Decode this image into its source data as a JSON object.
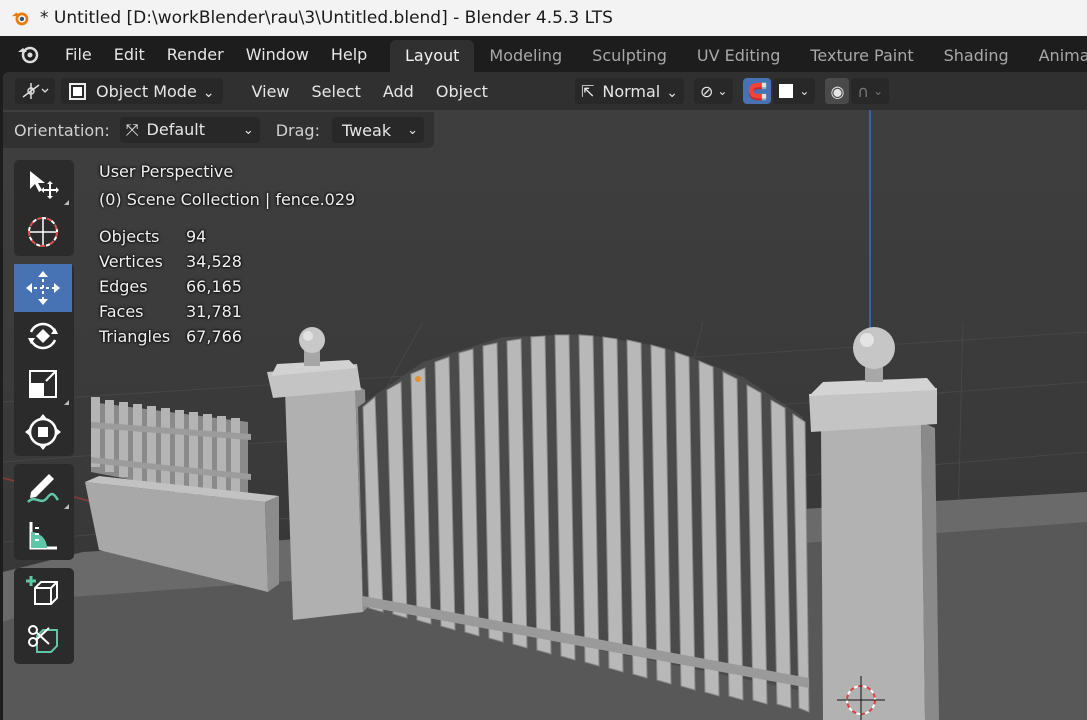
{
  "titlebar": {
    "title": "* Untitled [D:\\workBlender\\rau\\3\\Untitled.blend] - Blender 4.5.3 LTS"
  },
  "menu": {
    "items": [
      "File",
      "Edit",
      "Render",
      "Window",
      "Help"
    ]
  },
  "workspaces": {
    "tabs": [
      "Layout",
      "Modeling",
      "Sculpting",
      "UV Editing",
      "Texture Paint",
      "Shading",
      "Animation"
    ],
    "active": "Layout"
  },
  "header": {
    "mode": "Object Mode",
    "menus": [
      "View",
      "Select",
      "Add",
      "Object"
    ],
    "transform_orientation": "Normal"
  },
  "tool_settings": {
    "orientation_label": "Orientation:",
    "orientation_value": "Default",
    "drag_label": "Drag:",
    "drag_value": "Tweak"
  },
  "toolbar": {
    "tools": [
      "select-box-icon",
      "cursor-icon",
      "move-icon",
      "rotate-icon",
      "scale-icon",
      "transform-icon",
      "annotate-icon",
      "measure-icon",
      "add-cube-icon",
      "scale-cage-icon"
    ],
    "active": "move-icon"
  },
  "overlay": {
    "view_name": "User Perspective",
    "collection": "(0) Scene Collection | fence.029",
    "stats": [
      {
        "label": "Objects",
        "value": "94"
      },
      {
        "label": "Vertices",
        "value": "34,528"
      },
      {
        "label": "Edges",
        "value": "66,165"
      },
      {
        "label": "Faces",
        "value": "31,781"
      },
      {
        "label": "Triangles",
        "value": "67,766"
      }
    ]
  },
  "colors": {
    "accent": "#4772b3",
    "header_bg": "#303030",
    "viewport_bg": "#3c3c3c",
    "blender_orange": "#e87d0d"
  }
}
